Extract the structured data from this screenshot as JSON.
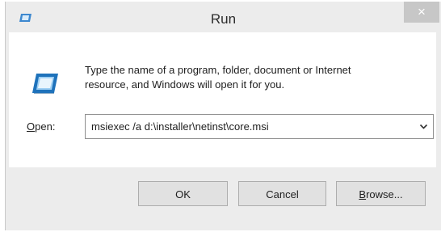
{
  "window": {
    "title": "Run",
    "close_label": "×",
    "title_icon": "run-icon",
    "accent_color": "#1e72bb"
  },
  "dialog": {
    "message_line1": "Type the name of a program, folder, document or Internet",
    "message_line2": "resource, and Windows will open it for you.",
    "open_label_mnemonic": "O",
    "open_label_rest": "pen:",
    "open_value": "msiexec /a d:\\installer\\netinst\\core.msi",
    "dropdown_icon": "chevron-down-icon"
  },
  "buttons": {
    "ok_label": "OK",
    "cancel_label": "Cancel",
    "browse_mnemonic": "B",
    "browse_rest": "rowse..."
  }
}
